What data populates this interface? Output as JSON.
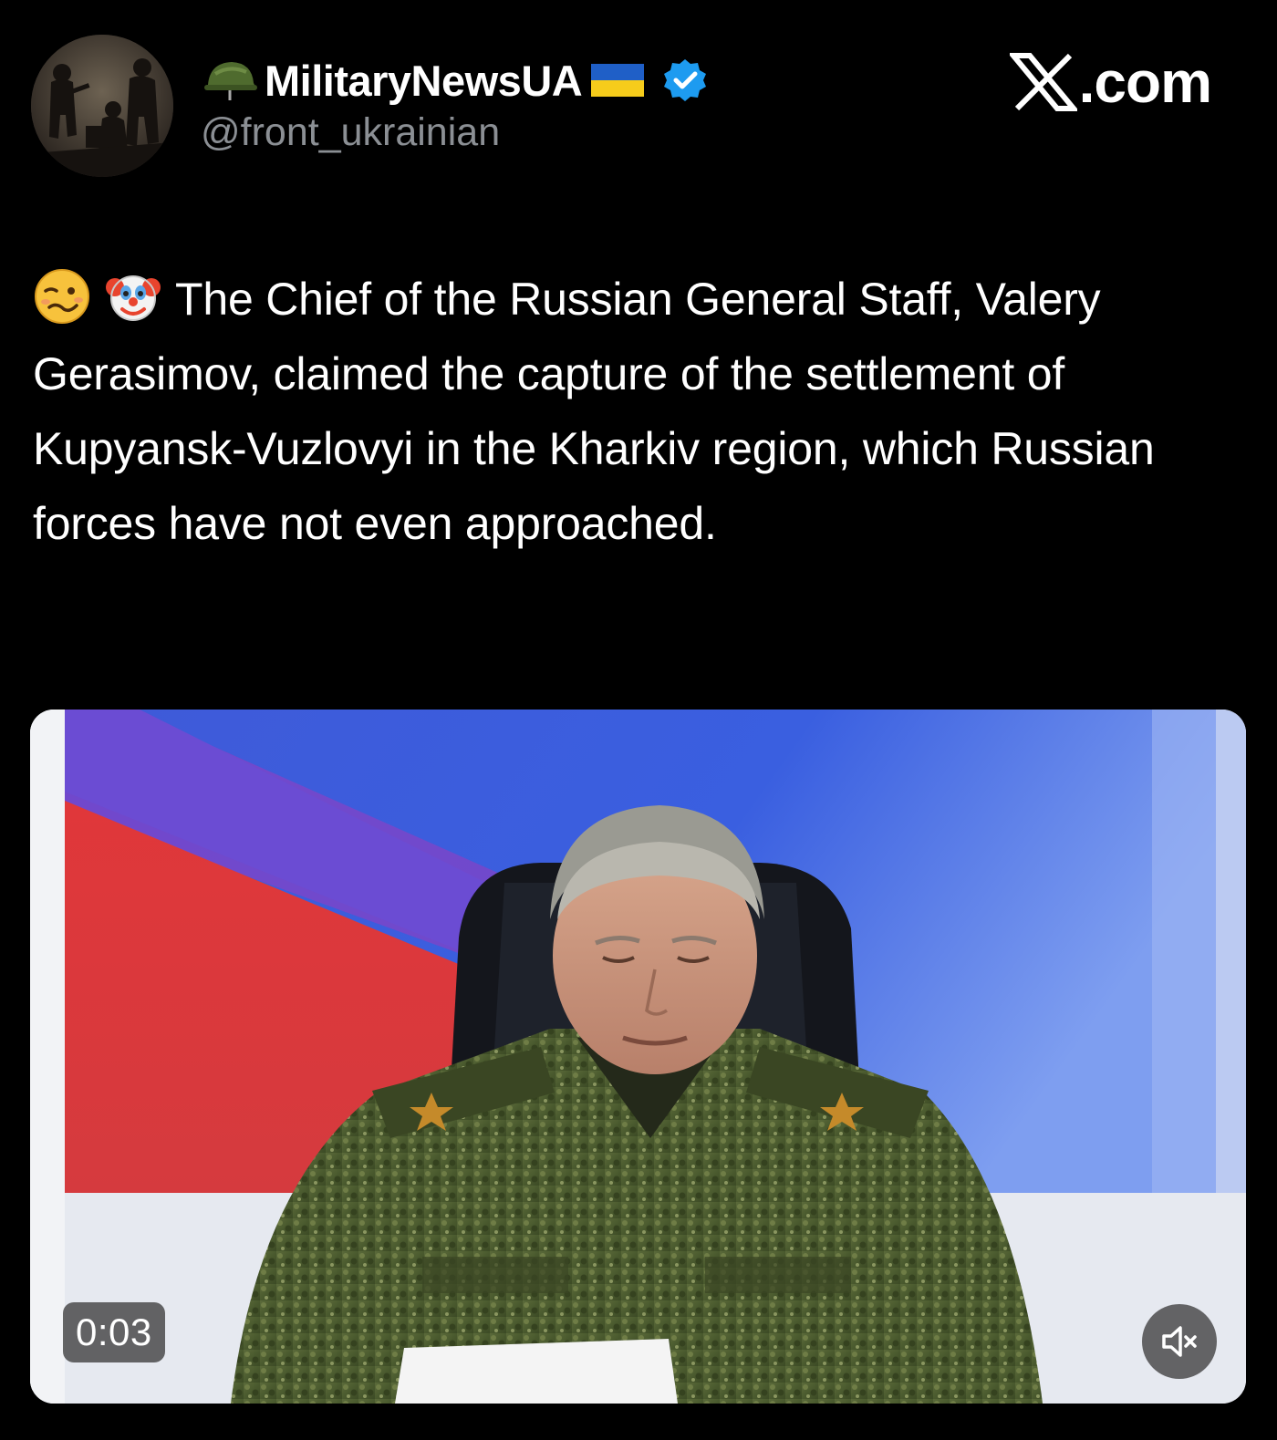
{
  "header": {
    "display_name": "MilitaryNewsUA",
    "handle": "@front_ukrainian",
    "site": "com",
    "icons": {
      "avatar": "soldiers-silhouette-avatar",
      "before_name": "military-helmet-icon",
      "after_name": "ukraine-flag-icon",
      "badge": "verified-badge-icon",
      "site_logo": "x-logo-icon"
    },
    "colors": {
      "verified": "#1d9bf0",
      "flag_blue": "#1f5fc7",
      "flag_yellow": "#f6cc1b",
      "handle": "#8b8f94"
    }
  },
  "tweet": {
    "emojis": [
      "woozy-face-emoji",
      "clown-face-emoji"
    ],
    "text": "The Chief of the Russian General Staff, Valery Gerasimov, claimed the capture of the settlement of Kupyansk-Vuzlovyi in the Kharkiv region, which Russian forces have not even approached."
  },
  "media": {
    "type": "video",
    "timestamp": "0:03",
    "mute_icon": "speaker-muted-icon"
  }
}
